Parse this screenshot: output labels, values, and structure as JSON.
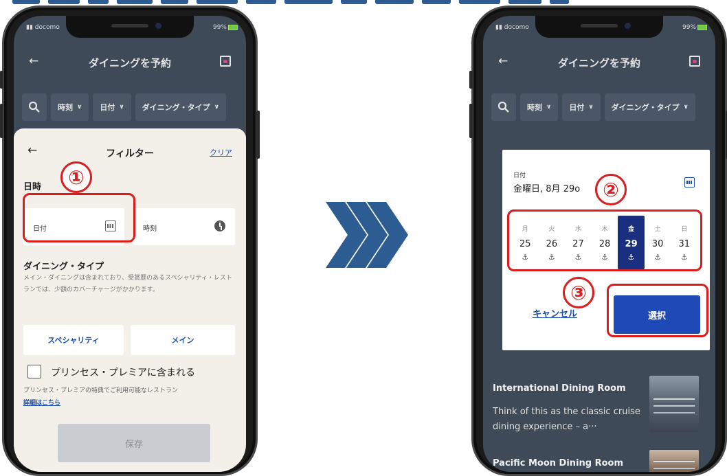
{
  "left_phone": {
    "status": {
      "carrier": "docomo",
      "battery": "99%"
    },
    "app": {
      "back_glyph": "←",
      "title": "ダイニングを予約",
      "chips": [
        {
          "label": "時刻",
          "chevron": "∨"
        },
        {
          "label": "日付",
          "chevron": "∨"
        },
        {
          "label": "ダイニング・タイプ",
          "chevron": "∨"
        }
      ]
    },
    "sheet": {
      "back_glyph": "←",
      "title": "フィルター",
      "clear": "クリア",
      "datetime_heading": "日時",
      "date_field": "日付",
      "time_field": "時刻",
      "dining_type_heading": "ダイニング・タイプ",
      "dining_type_desc": "メイン・ダイニングは含まれており、受賞歴のあるスペシャリティ・レストランでは、少額のカバーチャージがかかります。",
      "specialty_button": "スペシャリティ",
      "main_button": "メイン",
      "premier_label": "プリンセス・プレミアに含まれる",
      "premier_desc": "プリンセス・プレミアの特典でご利用可能なレストラン",
      "details_link": "詳細はこちら",
      "save_button": "保存"
    },
    "callout": "①"
  },
  "right_phone": {
    "status": {
      "carrier": "docomo",
      "battery": "99%"
    },
    "app": {
      "back_glyph": "←",
      "title": "ダイニングを予約",
      "chips": [
        {
          "label": "時刻",
          "chevron": "∨"
        },
        {
          "label": "日付",
          "chevron": "∨"
        },
        {
          "label": "ダイニング・タイプ",
          "chevron": "∨"
        }
      ]
    },
    "dialog": {
      "label": "日付",
      "selected_date": "金曜日, 8月 29o",
      "days": [
        {
          "weekday": "月",
          "date": "25",
          "icon": "⚓"
        },
        {
          "weekday": "火",
          "date": "26",
          "icon": "⚓"
        },
        {
          "weekday": "水",
          "date": "27",
          "icon": "⚓"
        },
        {
          "weekday": "木",
          "date": "28",
          "icon": "⚓"
        },
        {
          "weekday": "金",
          "date": "29",
          "icon": "⚓"
        },
        {
          "weekday": "土",
          "date": "30",
          "icon": "⚓"
        },
        {
          "weekday": "日",
          "date": "31",
          "icon": "⚓"
        }
      ],
      "cancel": "キャンセル",
      "select": "選択"
    },
    "cards": [
      {
        "title": "International Dining Room",
        "desc": "Think of this as the classic cruise dining experience – a···"
      },
      {
        "title": "Pacific Moon Dining Room",
        "desc": ""
      }
    ],
    "callouts": [
      "②",
      "③"
    ]
  },
  "colors": {
    "accent": "#1e49b6",
    "annotation": "#e01a1a",
    "arrow": "#2d5c93"
  }
}
